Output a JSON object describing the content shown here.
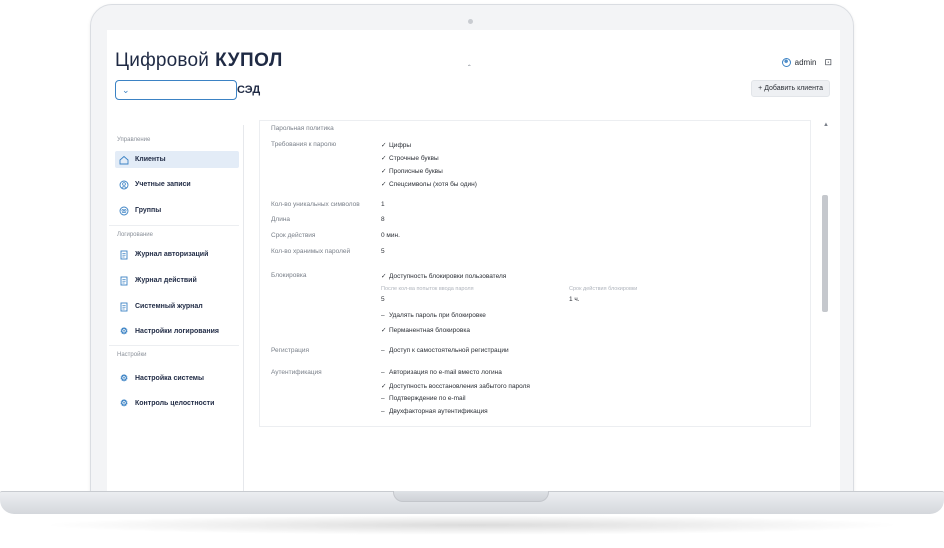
{
  "brand": {
    "name": "Цифровой",
    "bold": "КУПОЛ"
  },
  "selector": {
    "value": "СЭД"
  },
  "user": {
    "name": "admin"
  },
  "toolbar": {
    "add_client": "+ Добавить клиента"
  },
  "sidebar": {
    "sections": [
      {
        "title": "Управление",
        "items": [
          "Клиенты",
          "Учетные записи",
          "Группы"
        ]
      },
      {
        "title": "Логирование",
        "items": [
          "Журнал авторизаций",
          "Журнал действий",
          "Системный журнал",
          "Настройки логирования"
        ]
      },
      {
        "title": "Настройки",
        "items": [
          "Настройка системы",
          "Контроль целостности"
        ]
      }
    ]
  },
  "content": {
    "section_title": "Парольная политика",
    "password_req_label": "Требования к паролю",
    "password_reqs": [
      "Цифры",
      "Строчные буквы",
      "Прописные буквы",
      "Спецсимволы (хотя бы один)"
    ],
    "unique_chars_label": "Кол-во уникальных символов",
    "unique_chars_value": "1",
    "length_label": "Длина",
    "length_value": "8",
    "validity_label": "Срок действия",
    "validity_value": "0 мин.",
    "stored_label": "Кол-во хранимых паролей",
    "stored_value": "5",
    "lock_label": "Блокировка",
    "lock_enabled": "Доступность блокировки пользователя",
    "lock_attempts_label": "После кол-ва попыток ввода пароля",
    "lock_attempts_value": "5",
    "lock_period_label": "Срок действия блокировки",
    "lock_period_value": "1 ч.",
    "lock_delete": "Удалять пароль при блокировке",
    "lock_permanent": "Перманентная блокировка",
    "reg_label": "Регистрация",
    "reg_self": "Доступ к самостоятельной регистрации",
    "auth_label": "Аутентификация",
    "auth_items": [
      "Авторизация по e-mail вместо логина",
      "Доступность восстановления забытого пароля",
      "Подтверждение по e-mail",
      "Двухфакторная аутентификация"
    ]
  }
}
